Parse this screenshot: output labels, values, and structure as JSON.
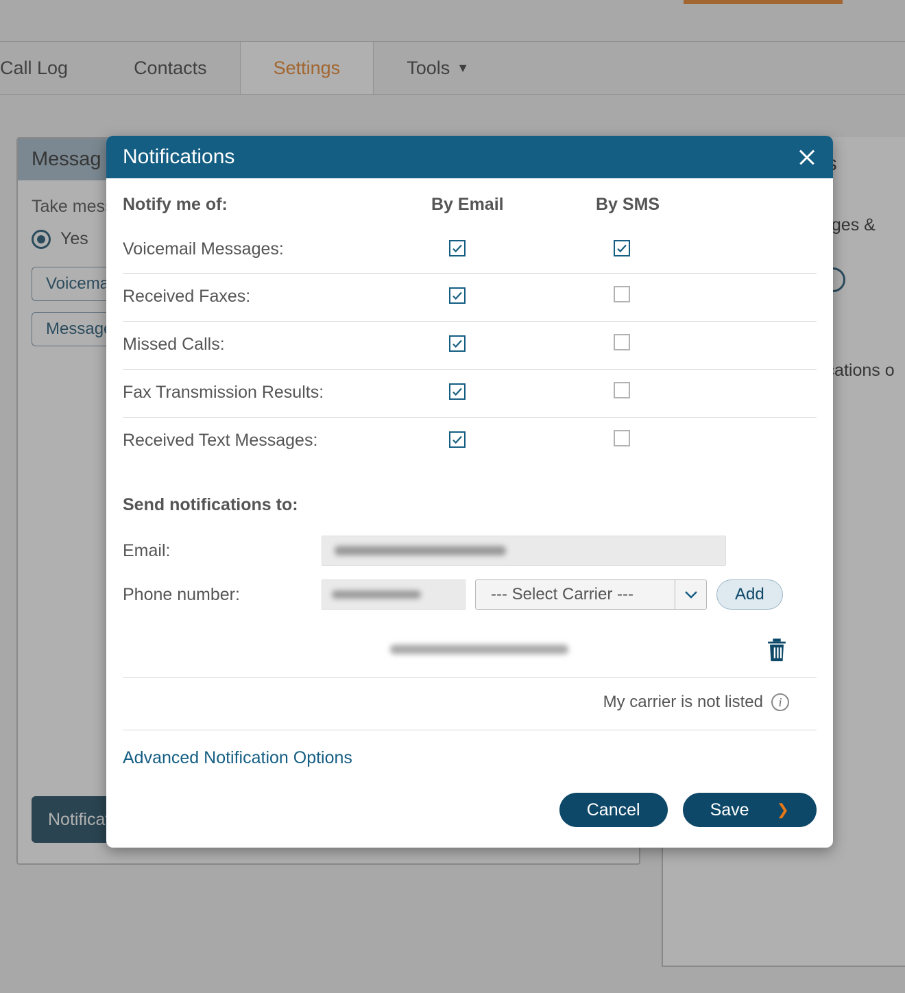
{
  "nav": {
    "tabs": [
      {
        "label": "Call Log"
      },
      {
        "label": "Contacts"
      },
      {
        "label": "Settings"
      },
      {
        "label": "Tools"
      }
    ]
  },
  "background_panel": {
    "header": "Messag",
    "take_messages_label": "Take mess",
    "yes_label": "Yes",
    "voicemail_btn": "Voicemai",
    "message_btn": "Message",
    "notifications_btn": "Notifications"
  },
  "right_panel": {
    "title_fragment": "ls",
    "line1_fragment": "ages &",
    "line2_fragment": "ications o"
  },
  "modal": {
    "title": "Notifications",
    "notify_label": "Notify me of:",
    "col_email": "By Email",
    "col_sms": "By SMS",
    "rows": [
      {
        "label": "Voicemail Messages:",
        "email": true,
        "sms": true
      },
      {
        "label": "Received Faxes:",
        "email": true,
        "sms": false
      },
      {
        "label": "Missed Calls:",
        "email": true,
        "sms": false
      },
      {
        "label": "Fax Transmission Results:",
        "email": true,
        "sms": false
      },
      {
        "label": "Received Text Messages:",
        "email": true,
        "sms": false
      }
    ],
    "send_to_label": "Send notifications to:",
    "email_label": "Email:",
    "phone_label": "Phone number:",
    "carrier_placeholder": "--- Select Carrier ---",
    "add_label": "Add",
    "carrier_not_listed": "My carrier is not listed",
    "advanced_link": "Advanced Notification Options",
    "cancel_label": "Cancel",
    "save_label": "Save"
  }
}
